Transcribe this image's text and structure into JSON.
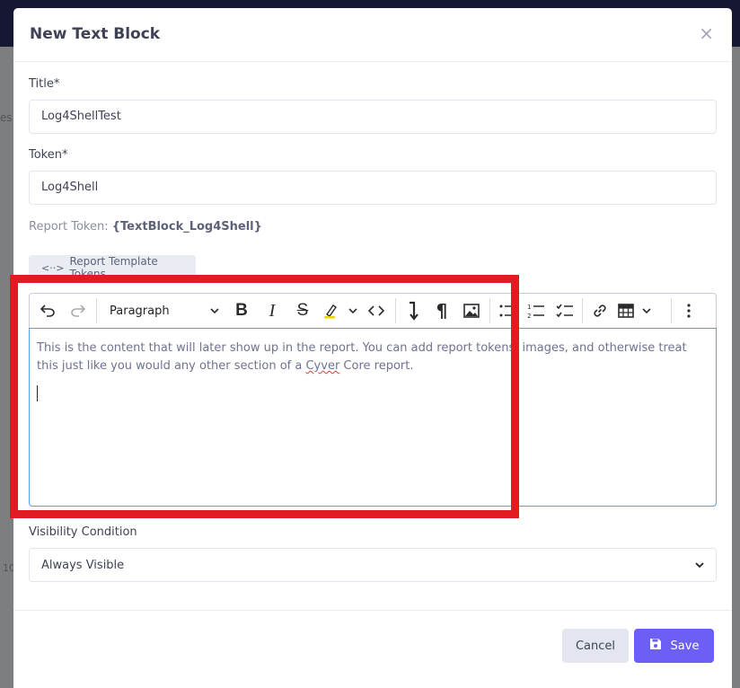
{
  "background": {
    "frag_left": "es",
    "frag_bottom": "10"
  },
  "modal": {
    "title": "New Text Block",
    "close_icon": "×",
    "title_label": "Title*",
    "title_value": "Log4ShellTest",
    "token_label": "Token*",
    "token_value": "Log4Shell",
    "report_token_label": "Report Token:",
    "report_token_value": "{TextBlock_Log4Shell}",
    "tokens_button": "Report Template Tokens",
    "editor": {
      "paragraph_style": "Paragraph",
      "content_part1": "This is the content that will later show up in the report. You can add report tokens, images, and otherwise treat this just like you would any other section of a ",
      "content_misspelled": "Cyver",
      "content_part2": " Core report."
    },
    "visibility_label": "Visibility Condition",
    "visibility_value": "Always Visible",
    "cancel_button": "Cancel",
    "save_button": "Save"
  },
  "colors": {
    "accent": "#6c5ff5",
    "highlight": "#e11b22",
    "focus": "#4ea1f0"
  }
}
